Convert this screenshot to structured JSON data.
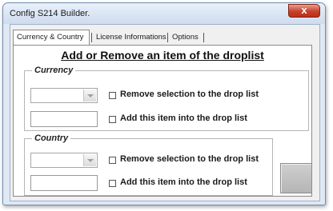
{
  "window": {
    "title": "Config S214 Builder.",
    "close_glyph": "x"
  },
  "tabs": [
    {
      "label": "Currency & Country",
      "active": true
    },
    {
      "label": "License Informations",
      "active": false
    },
    {
      "label": "Options",
      "active": false
    }
  ],
  "panel": {
    "heading": "Add or Remove an item of the droplist"
  },
  "currency": {
    "legend": "Currency",
    "combo_value": "",
    "remove_label": "Remove selection to the drop list",
    "input_value": "",
    "add_label": "Add this item into the drop list"
  },
  "country": {
    "legend": "Country",
    "combo_value": "",
    "remove_label": "Remove selection to the drop list",
    "input_value": "",
    "add_label": "Add this item into the drop list"
  },
  "icons": {
    "dropdown": "chevron-down-icon",
    "close": "close-icon"
  }
}
